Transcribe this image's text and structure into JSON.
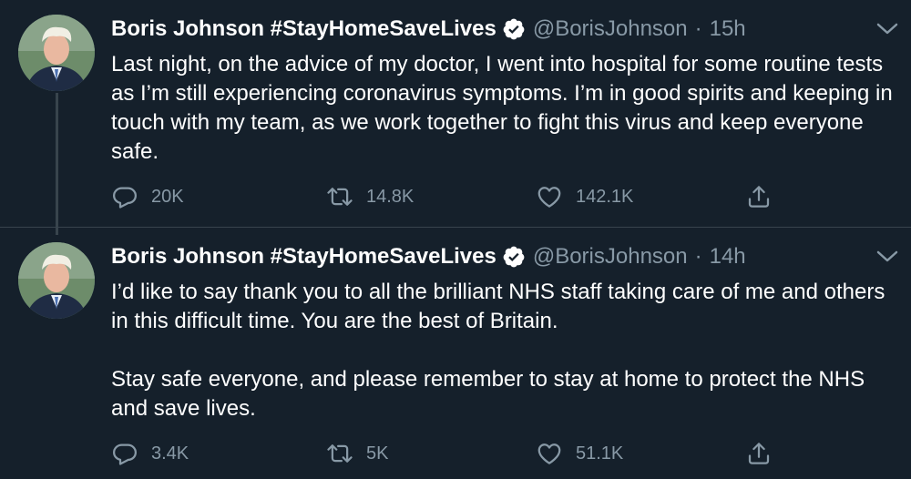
{
  "tweets": [
    {
      "display_name": "Boris Johnson #StayHomeSaveLives",
      "handle": "@BorisJohnson",
      "separator": "·",
      "time": "15h",
      "paragraphs": [
        "Last night, on the advice of my doctor, I went into hospital for some routine tests as I’m still experiencing coronavirus symptoms. I’m in good spirits and keeping in touch with my team, as we work together to fight this virus and keep everyone safe."
      ],
      "replies": "20K",
      "retweets": "14.8K",
      "likes": "142.1K"
    },
    {
      "display_name": "Boris Johnson #StayHomeSaveLives",
      "handle": "@BorisJohnson",
      "separator": "·",
      "time": "14h",
      "paragraphs": [
        "I’d like to say thank you to all the brilliant NHS staff taking care of me and others in this difficult time. You are the best of Britain.",
        "Stay safe everyone, and please remember to stay at home to protect the NHS and save lives."
      ],
      "replies": "3.4K",
      "retweets": "5K",
      "likes": "51.1K"
    }
  ],
  "icons": {
    "verified": "verified-badge-icon",
    "caret": "chevron-down-icon",
    "reply": "reply-icon",
    "retweet": "retweet-icon",
    "like": "heart-icon",
    "share": "share-icon"
  },
  "colors": {
    "background": "#15202b",
    "text_primary": "#ffffff",
    "text_secondary": "#8899a6",
    "divider": "#38444d"
  }
}
